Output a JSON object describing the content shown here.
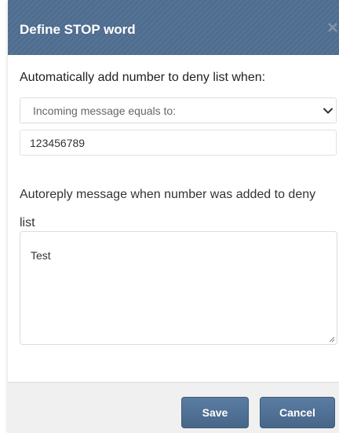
{
  "dialog": {
    "title": "Define STOP word",
    "close_glyph": "×",
    "rule_label": "Automatically add number to deny list when:",
    "condition": {
      "selected": "Incoming message equals to:"
    },
    "keyword_value": "123456789",
    "autoreply_label": "Autoreply message when number was added to deny list",
    "autoreply_value": "Test",
    "buttons": {
      "save": "Save",
      "cancel": "Cancel"
    }
  },
  "colors": {
    "header": "#4e6d8f",
    "button": "#4e6f93",
    "footer": "#f0f0f0"
  },
  "icons": {
    "close": "close-icon",
    "chevron": "chevron-down-icon",
    "resize": "resize-grip-icon"
  }
}
